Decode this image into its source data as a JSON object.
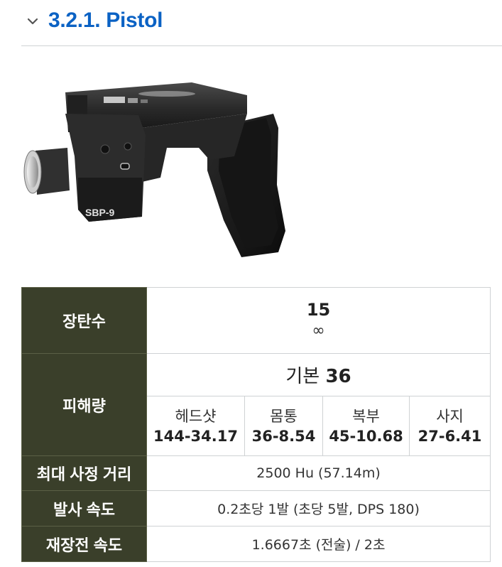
{
  "section": {
    "title": "3.2.1. Pistol",
    "toggle_icon": "chevron-down-icon",
    "accent_color": "#0b62c4"
  },
  "image": {
    "icon": "pistol-image",
    "alt": "Pistol"
  },
  "stats": {
    "header_bg": "#3a3f2a",
    "capacity": {
      "label": "장탄수",
      "magazine": "15",
      "reserve": "∞"
    },
    "damage": {
      "label": "피해량",
      "base_prefix": "기본",
      "base_value": "36",
      "parts": [
        {
          "name": "헤드샷",
          "value": "144-34.17"
        },
        {
          "name": "몸통",
          "value": "36-8.54"
        },
        {
          "name": "복부",
          "value": "45-10.68"
        },
        {
          "name": "사지",
          "value": "27-6.41"
        }
      ]
    },
    "range": {
      "label": "최대 사정 거리",
      "value": "2500 Hu (57.14m)"
    },
    "fire_rate": {
      "label": "발사 속도",
      "value": "0.2초당 1발 (초당 5발, DPS 180)"
    },
    "reload": {
      "label": "재장전 속도",
      "value": "1.6667초 (전술) / 2초"
    }
  }
}
